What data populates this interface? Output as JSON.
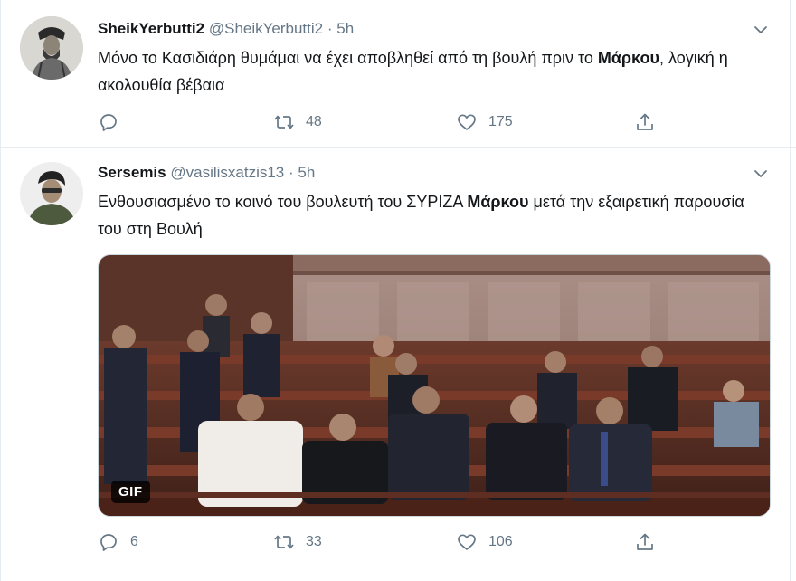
{
  "tweets": [
    {
      "name": "SheikYerbutti2",
      "handle": "@SheikYerbutti2",
      "separator": "·",
      "time": "5h",
      "text_before": "Μόνο το Κασιδιάρη θυμάμαι να έχει αποβληθεί από τη βουλή πριν το ",
      "text_bold": "Μάρκου",
      "text_after": ", λογική η ακολουθία βέβαια",
      "replies": "",
      "retweets": "48",
      "likes": "175"
    },
    {
      "name": "Sersemis",
      "handle": "@vasilisxatzis13",
      "separator": "·",
      "time": "5h",
      "text_before": "Ενθουσιασμένο το κοινό του βουλευτή του ΣΥΡΙΖΑ ",
      "text_bold": "Μάρκου",
      "text_after": " μετά την εξαιρετική παρουσία του στη Βουλή",
      "media_badge": "GIF",
      "replies": "6",
      "retweets": "33",
      "likes": "106"
    }
  ],
  "icons": {
    "reply": "reply-icon",
    "retweet": "retweet-icon",
    "like": "like-icon",
    "share": "share-icon",
    "caret": "chevron-down-icon"
  },
  "colors": {
    "text": "#14171a",
    "secondary": "#657786",
    "divider": "#e6ecf0"
  }
}
